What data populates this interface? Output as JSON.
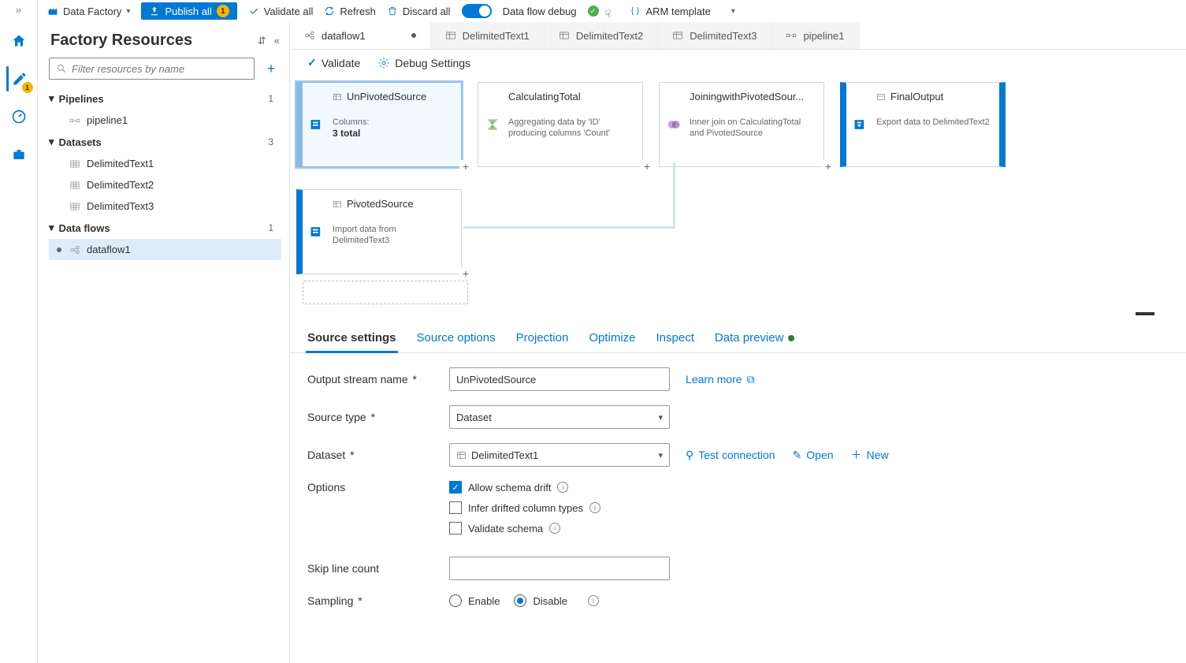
{
  "toolbar": {
    "factory_label": "Data Factory",
    "publish_label": "Publish all",
    "publish_count": "1",
    "validate_all": "Validate all",
    "refresh": "Refresh",
    "discard": "Discard all",
    "debug_label": "Data flow debug",
    "arm_label": "ARM template"
  },
  "rail": {
    "pending_count": "1"
  },
  "sidebar": {
    "title": "Factory Resources",
    "filter_placeholder": "Filter resources by name",
    "sections": {
      "pipelines": {
        "label": "Pipelines",
        "count": "1"
      },
      "datasets": {
        "label": "Datasets",
        "count": "3"
      },
      "dataflows": {
        "label": "Data flows",
        "count": "1"
      }
    },
    "items": {
      "pipeline1": "pipeline1",
      "dt1": "DelimitedText1",
      "dt2": "DelimitedText2",
      "dt3": "DelimitedText3",
      "df1": "dataflow1"
    }
  },
  "tabs": {
    "t0": "dataflow1",
    "t1": "DelimitedText1",
    "t2": "DelimitedText2",
    "t3": "DelimitedText3",
    "t4": "pipeline1"
  },
  "subtoolbar": {
    "validate": "Validate",
    "debug_settings": "Debug Settings"
  },
  "nodes": {
    "n1": {
      "title": "UnPivotedSource",
      "sub_label": "Columns:",
      "sub_value": "3 total"
    },
    "n2": {
      "title": "CalculatingTotal",
      "sub": "Aggregating data by 'ID' producing columns 'Count'"
    },
    "n3": {
      "title": "JoiningwithPivotedSour...",
      "sub": "Inner join on CalculatingTotal and PivotedSource"
    },
    "n4": {
      "title": "FinalOutput",
      "sub": "Export data to DelimitedText2"
    },
    "n5": {
      "title": "PivotedSource",
      "sub": "Import data from DelimitedText3"
    }
  },
  "config_tabs": {
    "source_settings": "Source settings",
    "source_options": "Source options",
    "projection": "Projection",
    "optimize": "Optimize",
    "inspect": "Inspect",
    "data_preview": "Data preview"
  },
  "form": {
    "output_stream_label": "Output stream name",
    "output_stream_value": "UnPivotedSource",
    "learn_more": "Learn more",
    "source_type_label": "Source type",
    "source_type_value": "Dataset",
    "dataset_label": "Dataset",
    "dataset_value": "DelimitedText1",
    "test_connection": "Test connection",
    "open": "Open",
    "new": "New",
    "options_label": "Options",
    "allow_drift": "Allow schema drift",
    "infer_types": "Infer drifted column types",
    "validate_schema": "Validate schema",
    "skip_label": "Skip line count",
    "sampling_label": "Sampling",
    "enable": "Enable",
    "disable": "Disable"
  }
}
